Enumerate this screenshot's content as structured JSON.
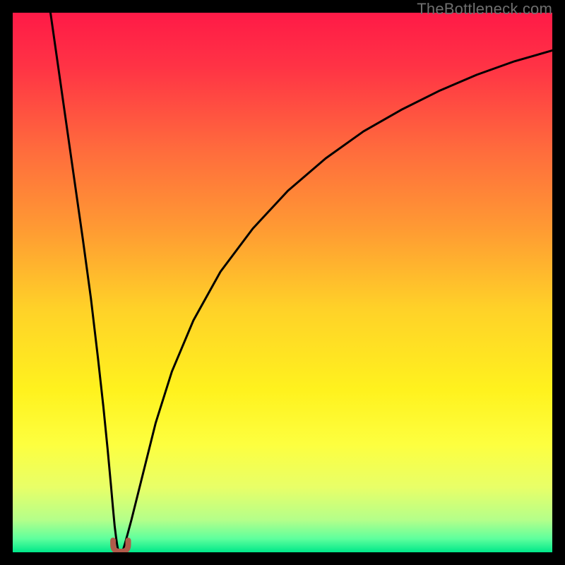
{
  "watermark": "TheBottleneck.com",
  "chart_data": {
    "type": "line",
    "title": "",
    "xlabel": "",
    "ylabel": "",
    "xlim": [
      0,
      100
    ],
    "ylim": [
      0,
      100
    ],
    "grid": false,
    "legend": false,
    "background_gradient": {
      "stops": [
        {
          "offset": 0.0,
          "color": "#ff1a47"
        },
        {
          "offset": 0.1,
          "color": "#ff3345"
        },
        {
          "offset": 0.25,
          "color": "#ff6a3d"
        },
        {
          "offset": 0.4,
          "color": "#ff9a33"
        },
        {
          "offset": 0.55,
          "color": "#ffd228"
        },
        {
          "offset": 0.7,
          "color": "#fff21e"
        },
        {
          "offset": 0.8,
          "color": "#fdff3f"
        },
        {
          "offset": 0.88,
          "color": "#e8ff68"
        },
        {
          "offset": 0.94,
          "color": "#b4ff8a"
        },
        {
          "offset": 0.975,
          "color": "#5eff9d"
        },
        {
          "offset": 1.0,
          "color": "#00e88a"
        }
      ]
    },
    "series": [
      {
        "name": "left-branch",
        "stroke": "#000000",
        "stroke_width": 3,
        "x": [
          7.0,
          9.0,
          11.0,
          13.0,
          14.5,
          15.8,
          16.8,
          17.6,
          18.2,
          18.6,
          18.9,
          19.15,
          19.35,
          19.5
        ],
        "y": [
          100.0,
          86.0,
          72.0,
          58.0,
          47.0,
          36.0,
          27.0,
          19.0,
          12.5,
          8.0,
          4.8,
          2.8,
          1.4,
          0.6
        ]
      },
      {
        "name": "right-branch",
        "stroke": "#000000",
        "stroke_width": 3,
        "x": [
          20.5,
          20.8,
          21.3,
          22.0,
          23.0,
          24.5,
          26.5,
          29.5,
          33.5,
          38.5,
          44.5,
          51.0,
          58.0,
          65.0,
          72.0,
          79.0,
          86.0,
          93.0,
          100.0
        ],
        "y": [
          0.6,
          1.6,
          3.4,
          6.0,
          10.0,
          16.0,
          24.0,
          33.5,
          43.0,
          52.0,
          60.0,
          67.0,
          73.0,
          78.0,
          82.0,
          85.5,
          88.5,
          91.0,
          93.0
        ]
      },
      {
        "name": "trough-marker",
        "type": "marker",
        "shape": "u-shape",
        "x": 20.0,
        "y": 0.0,
        "fill": "#b15a4a",
        "width_frac": 0.028,
        "height_frac": 0.022
      }
    ]
  }
}
